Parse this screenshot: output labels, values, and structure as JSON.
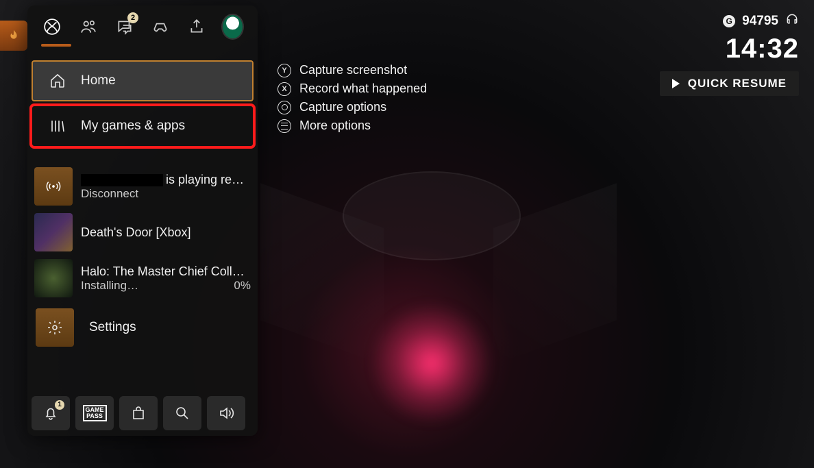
{
  "hud": {
    "gamerscore": "94795",
    "clock": "14:32",
    "quick_resume_label": "QUICK RESUME"
  },
  "flame_badge": {
    "icon": "flame-icon"
  },
  "top_tabs": {
    "messages_badge": "2"
  },
  "menu": {
    "home": "Home",
    "my_games": "My games & apps"
  },
  "cards": {
    "remote": {
      "status_suffix": "is playing rem…",
      "action": "Disconnect"
    },
    "game1": {
      "title": "Death's Door [Xbox]"
    },
    "game2": {
      "title": "Halo: The Master Chief Collection",
      "status": "Installing…",
      "progress": "0%"
    }
  },
  "settings": {
    "label": "Settings"
  },
  "bottom": {
    "notifications_badge": "1",
    "gamepass_text": "GAME\nPASS"
  },
  "context": {
    "screenshot": "Capture screenshot",
    "record": "Record what happened",
    "options": "Capture options",
    "more": "More options"
  }
}
